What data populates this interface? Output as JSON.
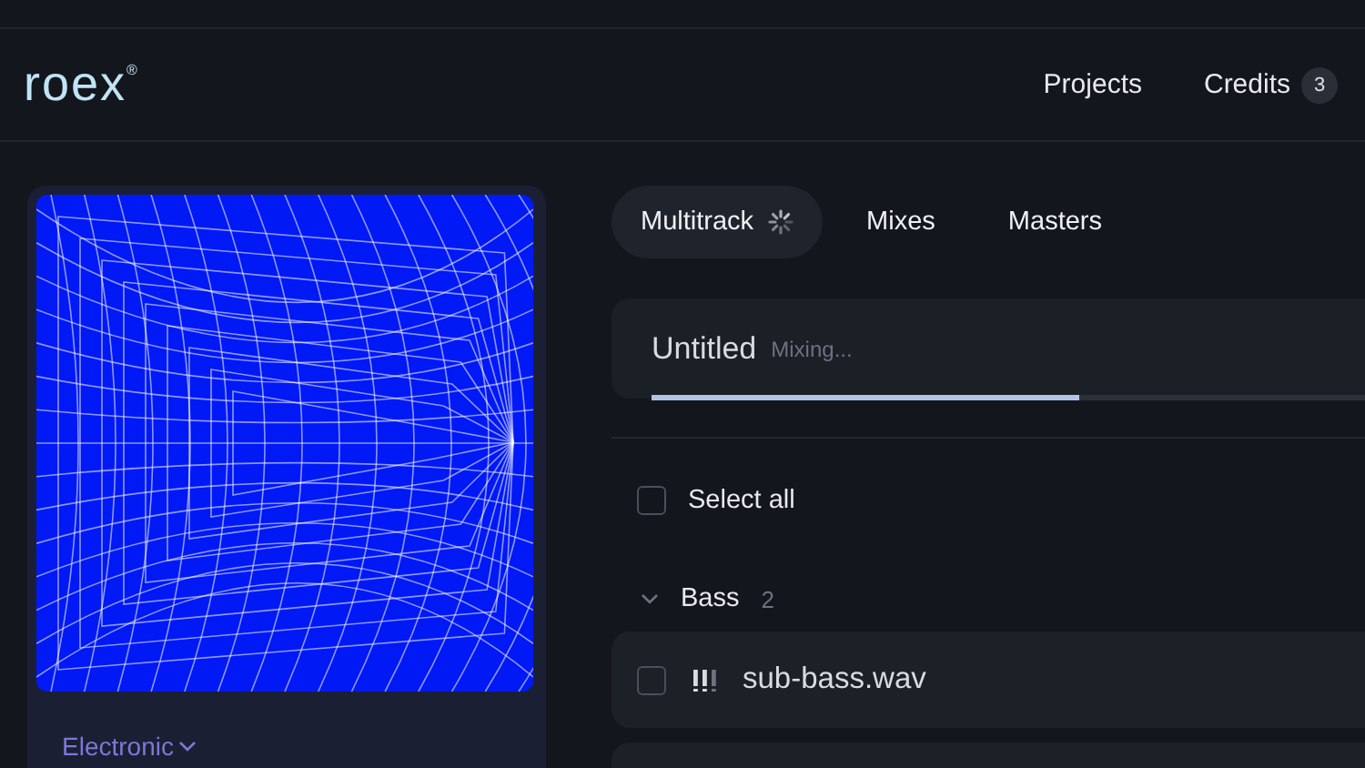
{
  "header": {
    "logo": "roex$^{®}$",
    "nav": [
      {
        "label": "Projects"
      },
      {
        "label": "Credits",
        "badge": "3"
      }
    ]
  },
  "artwork": {
    "genre": "Electronic"
  },
  "tabs": [
    {
      "label": "Multitrack",
      "selected": true,
      "loading": true
    },
    {
      "label": "Mixes",
      "selected": false,
      "loading": false
    },
    {
      "label": "Masters",
      "selected": false,
      "loading": false
    }
  ],
  "project": {
    "title": "Untitled",
    "status": "Mixing...",
    "level": 0.6
  },
  "select_all": {
    "label": "Select all",
    "checked": false
  },
  "groups": [
    {
      "name": "Bass",
      "count": "2",
      "expanded": true,
      "tracks": [
        {
          "name": "sub-bass.wav",
          "checked": false
        }
      ]
    }
  ]
}
